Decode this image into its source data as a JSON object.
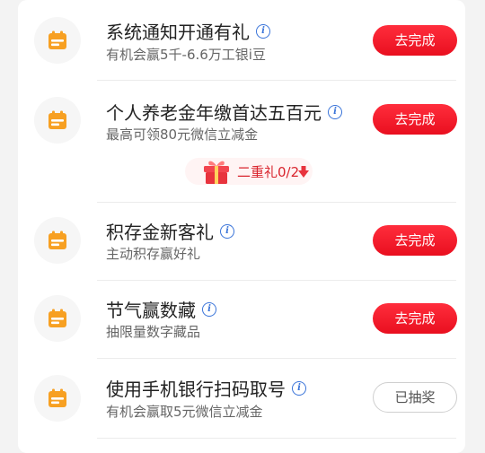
{
  "tasks": [
    {
      "title": "系统通知开通有礼",
      "subtitle": "有机会赢5千-6.6万工银i豆",
      "button": "去完成",
      "button_state": "active"
    },
    {
      "title": "个人养老金年缴首达五百元",
      "subtitle": "最高可领80元微信立减金",
      "button": "去完成",
      "button_state": "active"
    },
    {
      "title": "积存金新客礼",
      "subtitle": "主动积存赢好礼",
      "button": "去完成",
      "button_state": "active"
    },
    {
      "title": "节气赢数藏",
      "subtitle": "抽限量数字藏品",
      "button": "去完成",
      "button_state": "active"
    },
    {
      "title": "使用手机银行扫码取号",
      "subtitle": "有机会赢取5元微信立减金",
      "button": "已抽奖",
      "button_state": "done"
    }
  ],
  "bonus": {
    "label": "二重礼0/2"
  },
  "colors": {
    "accent_red": "#e90f1f",
    "icon_orange": "#f7a022",
    "info_blue": "#3a74d9"
  },
  "icons": {
    "task": "calendar-icon",
    "info": "info-icon",
    "bonus": "gift-icon",
    "arrow": "arrow-down-icon"
  }
}
